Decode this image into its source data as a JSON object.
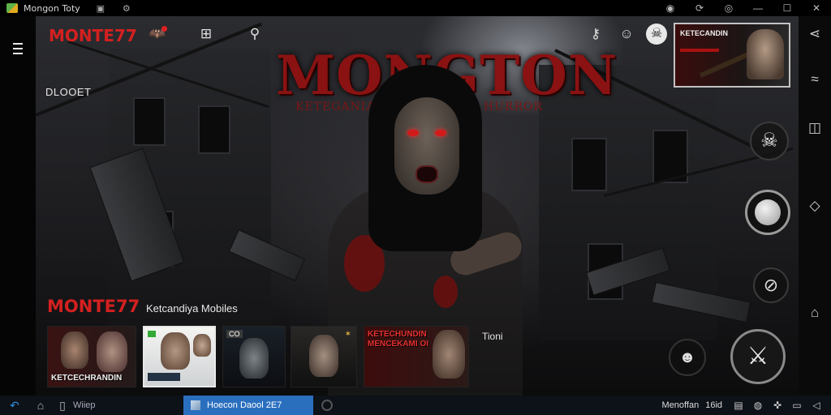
{
  "window": {
    "title": "Mongon Toty",
    "controls": {
      "minimize": "—",
      "maximize": "☐",
      "close": "✕"
    }
  },
  "game": {
    "logo": "MONTE77",
    "banner_title": "MONGTON",
    "banner_subtitle": "KETEGANIAN   MMENGANIA HURROR",
    "section_label": "DLOOET",
    "header_icons": [
      "bat-icon",
      "inventory-icon",
      "location-pin-icon",
      "key-icon",
      "chat-icon",
      "skull-icon"
    ],
    "promo": {
      "text": "KETECANDIN",
      "subtext": ""
    },
    "carousel": {
      "logo": "MONTE77",
      "title": "Ketcandiya Mobiles",
      "more_label": "Tioni",
      "items": [
        {
          "caption": "KETCECHRANDIN",
          "tag": ""
        },
        {
          "caption": "",
          "tag": ""
        },
        {
          "caption": "",
          "tag": "CO"
        },
        {
          "caption": "",
          "tag": ""
        },
        {
          "caption": "KETECHUNDIN MENCEKAMI OI",
          "tag": ""
        }
      ]
    }
  },
  "taskbar": {
    "search_label": "Wiiep",
    "window_label": "Hoecon Daool 2E7",
    "clock": "Menoffan",
    "date": "16id"
  },
  "colors": {
    "accent_red": "#d42020",
    "taskbar_active": "#2a6fbe"
  }
}
